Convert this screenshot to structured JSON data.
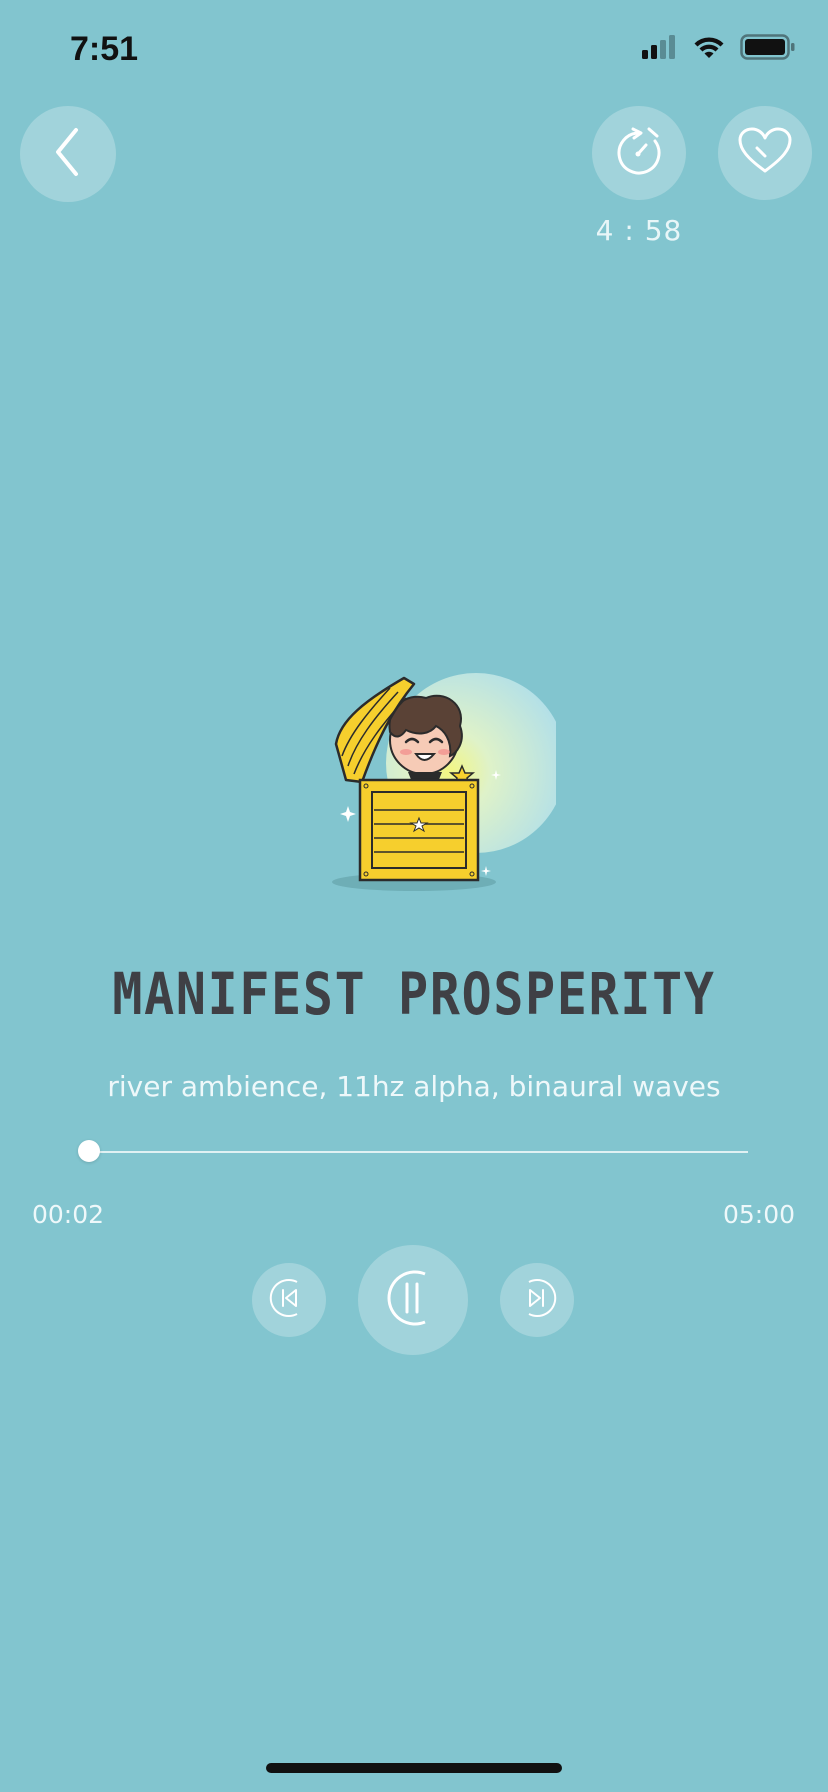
{
  "status_bar": {
    "time": "7:51"
  },
  "header": {
    "back_icon": "chevron-left-icon",
    "timer_icon": "stopwatch-icon",
    "favorite_icon": "heart-icon",
    "timer_readout": "4 : 58"
  },
  "track": {
    "title": "MANIFEST PROSPERITY",
    "subtitle": "river ambience, 11hz alpha, binaural waves",
    "artwork_icon": "treasure-chest-character-illustration"
  },
  "player": {
    "elapsed": "00:02",
    "total": "05:00",
    "progress": 0.007,
    "prev_icon": "skip-back-icon",
    "play_pause_icon": "pause-icon",
    "next_icon": "skip-forward-icon"
  },
  "colors": {
    "background": "#82c5cf",
    "title": "#3f4045",
    "text_light": "#eef8fa",
    "button_fill": "rgba(255,255,255,0.25)"
  }
}
